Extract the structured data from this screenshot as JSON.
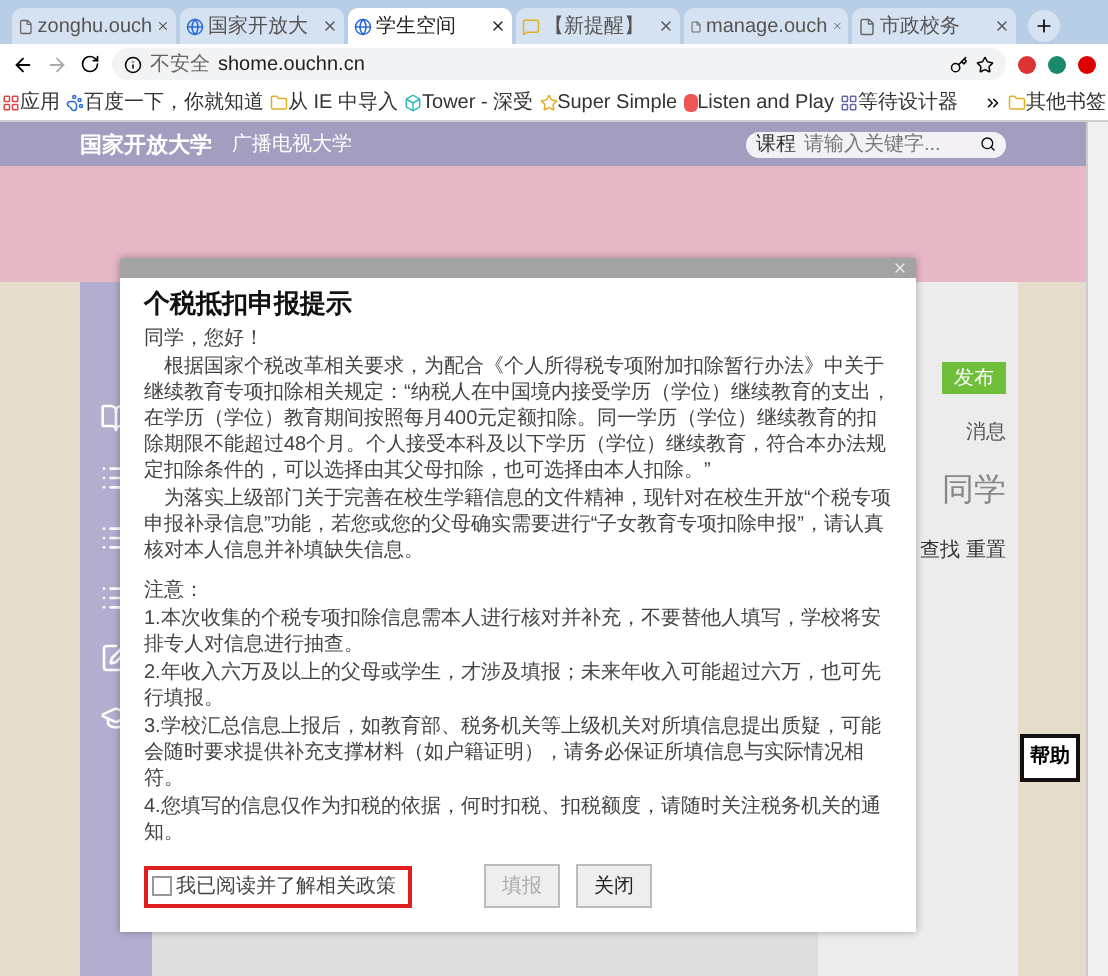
{
  "browser": {
    "tabs": [
      {
        "title": "zonghu.ouch",
        "kind": "page",
        "selected": false
      },
      {
        "title": "国家开放大",
        "kind": "site",
        "selected": false
      },
      {
        "title": "学生空间",
        "kind": "site",
        "selected": true
      },
      {
        "title": "【新提醒】",
        "kind": "forum",
        "selected": false
      },
      {
        "title": "manage.ouch",
        "kind": "page",
        "selected": false
      },
      {
        "title": "市政校务",
        "kind": "page",
        "selected": false
      }
    ],
    "address": {
      "security": "不安全",
      "url": "shome.ouchn.cn"
    },
    "bookmarks": [
      {
        "label": "应用",
        "kind": "apps"
      },
      {
        "label": "百度一下，你就知道",
        "kind": "paw"
      },
      {
        "label": "从 IE 中导入",
        "kind": "folder"
      },
      {
        "label": "Tower - 深受",
        "kind": "tower"
      },
      {
        "label": "Super Simple",
        "kind": "star"
      },
      {
        "label": "Listen and Play",
        "kind": "s"
      },
      {
        "label": "等待设计器",
        "kind": "grid"
      }
    ],
    "other_bookmarks": "其他书签"
  },
  "site": {
    "logo": "国家开放大学",
    "logo_sub": "广播电视大学",
    "search": {
      "category": "课程",
      "placeholder": "请输入关键字..."
    }
  },
  "sidebar": [
    {
      "kind": "book"
    },
    {
      "kind": "list"
    },
    {
      "kind": "list"
    },
    {
      "kind": "list"
    },
    {
      "kind": "pencil"
    },
    {
      "kind": "cap"
    }
  ],
  "right_panel": {
    "publish": "发布",
    "messages": "消息",
    "classmates": "同学",
    "find": "查找",
    "reset": "重置"
  },
  "dialog": {
    "title": "个税抵扣申报提示",
    "greeting": "同学，您好！",
    "paragraphs": [
      "根据国家个税改革相关要求，为配合《个人所得税专项附加扣除暂行办法》中关于继续教育专项扣除相关规定：“纳税人在中国境内接受学历（学位）继续教育的支出，在学历（学位）教育期间按照每月400元定额扣除。同一学历（学位）继续教育的扣除期限不能超过48个月。个人接受本科及以下学历（学位）继续教育，符合本办法规定扣除条件的，可以选择由其父母扣除，也可选择由本人扣除。”",
      "为落实上级部门关于完善在校生学籍信息的文件精神，现针对在校生开放“个税专项申报补录信息”功能，若您或您的父母确实需要进行“子女教育专项扣除申报”，请认真核对本人信息并补填缺失信息。"
    ],
    "notes_title": "注意：",
    "notes": [
      "1.本次收集的个税专项扣除信息需本人进行核对并补充，不要替他人填写，学校将安排专人对信息进行抽查。",
      "2.年收入六万及以上的父母或学生，才涉及填报；未来年收入可能超过六万，也可先行填报。",
      "3.学校汇总信息上报后，如教育部、税务机关等上级机关对所填信息提出质疑，可能会随时要求提供补充支撑材料（如户籍证明），请务必保证所填信息与实际情况相符。",
      "4.您填写的信息仅作为扣税的依据，何时扣税、扣税额度，请随时关注税务机关的通知。"
    ],
    "agree": {
      "label": "我已阅读并了解相关政策",
      "checked": false,
      "highlighted": true
    },
    "buttons": [
      {
        "label": "填报",
        "disabled": true
      },
      {
        "label": "关闭",
        "disabled": false
      }
    ]
  },
  "help": "帮助"
}
